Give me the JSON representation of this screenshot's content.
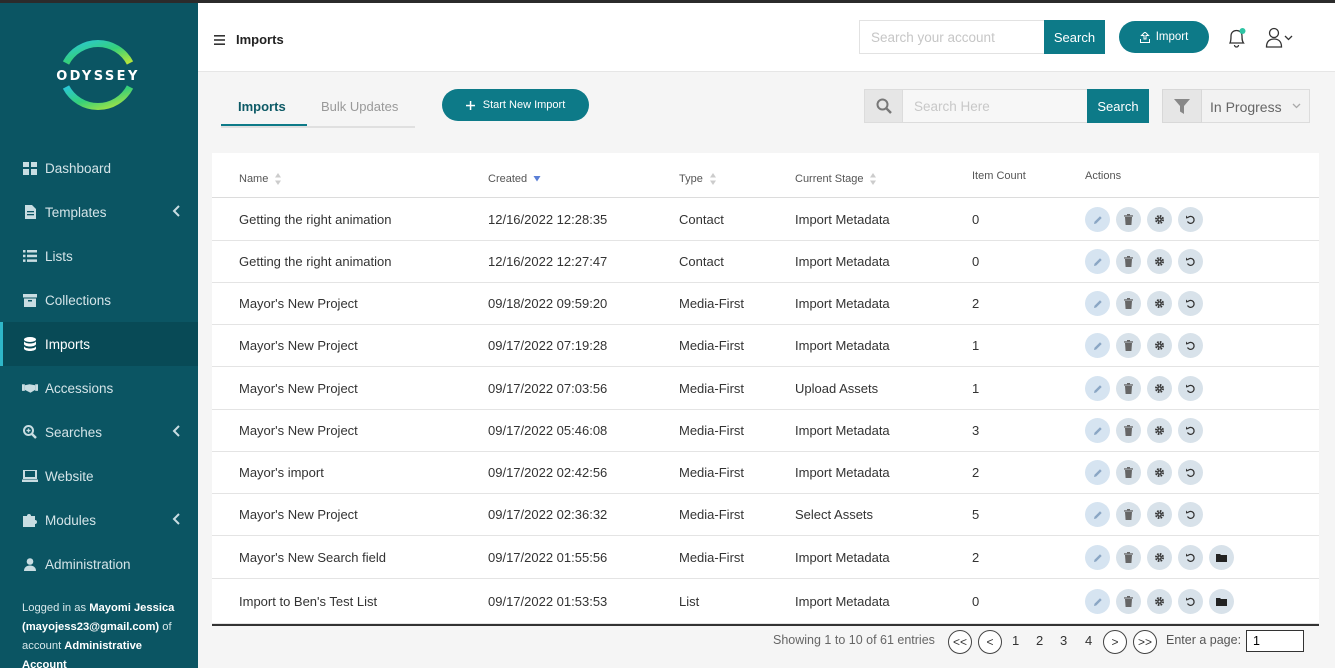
{
  "brand": {
    "name": "ODYSSEY"
  },
  "sidebar": {
    "items": [
      {
        "label": "Dashboard"
      },
      {
        "label": "Templates"
      },
      {
        "label": "Lists"
      },
      {
        "label": "Collections"
      },
      {
        "label": "Imports"
      },
      {
        "label": "Accessions"
      },
      {
        "label": "Searches"
      },
      {
        "label": "Website"
      },
      {
        "label": "Modules"
      },
      {
        "label": "Administration"
      }
    ],
    "login": {
      "prefix": "Logged in as ",
      "user_name": "Mayomi Jessica",
      "email": "(mayojess23@gmail.com)",
      "middle": " of account ",
      "account": "Administrative Account"
    }
  },
  "header": {
    "title": "Imports",
    "search_placeholder": "Search your account",
    "search_label": "Search",
    "import_label": "Import"
  },
  "tabs": [
    {
      "label": "Imports"
    },
    {
      "label": "Bulk Updates"
    }
  ],
  "start_import_label": "Start New Import",
  "list_search": {
    "placeholder": "Search Here",
    "button": "Search"
  },
  "status_filter": {
    "selected": "In Progress"
  },
  "table": {
    "columns": [
      "Name",
      "Created",
      "Type",
      "Current Stage",
      "Item Count",
      "Actions"
    ],
    "rows": [
      {
        "name": "Getting the right animation",
        "created": "12/16/2022 12:28:35",
        "type": "Contact",
        "stage": "Import Metadata",
        "count": "0"
      },
      {
        "name": "Getting the right animation",
        "created": "12/16/2022 12:27:47",
        "type": "Contact",
        "stage": "Import Metadata",
        "count": "0"
      },
      {
        "name": "Mayor's New Project",
        "created": "09/18/2022 09:59:20",
        "type": "Media-First",
        "stage": "Import Metadata",
        "count": "2"
      },
      {
        "name": "Mayor's New Project",
        "created": "09/17/2022 07:19:28",
        "type": "Media-First",
        "stage": "Import Metadata",
        "count": "1"
      },
      {
        "name": "Mayor's New Project",
        "created": "09/17/2022 07:03:56",
        "type": "Media-First",
        "stage": "Upload Assets",
        "count": "1"
      },
      {
        "name": "Mayor's New Project",
        "created": "09/17/2022 05:46:08",
        "type": "Media-First",
        "stage": "Import Metadata",
        "count": "3"
      },
      {
        "name": "Mayor's import",
        "created": "09/17/2022 02:42:56",
        "type": "Media-First",
        "stage": "Import Metadata",
        "count": "2"
      },
      {
        "name": "Mayor's New Project",
        "created": "09/17/2022 02:36:32",
        "type": "Media-First",
        "stage": "Select Assets",
        "count": "5"
      },
      {
        "name": "Mayor's New Search field",
        "created": "09/17/2022 01:55:56",
        "type": "Media-First",
        "stage": "Import Metadata",
        "count": "2"
      },
      {
        "name": "Import to Ben's Test List",
        "created": "09/17/2022 01:53:53",
        "type": "List",
        "stage": "Import Metadata",
        "count": "0"
      }
    ]
  },
  "pagination": {
    "summary": "Showing 1 to 10 of 61 entries",
    "first": "<<",
    "prev": "<",
    "pages": [
      "1",
      "2",
      "3",
      "4"
    ],
    "next": ">",
    "last": ">>",
    "enter_label": "Enter a page:",
    "page_value": "1"
  },
  "colors": {
    "sidebar": "#0b5563",
    "accent": "#0d7a88"
  }
}
